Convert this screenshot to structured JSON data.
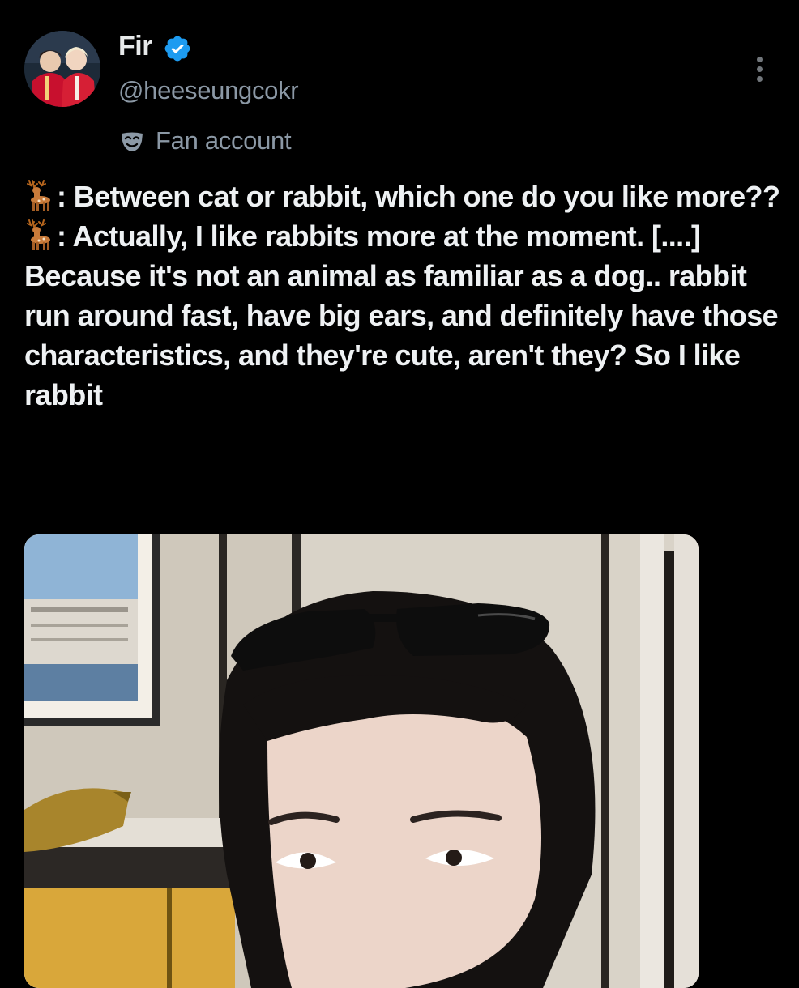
{
  "author": {
    "display_name": "Fir",
    "handle": "@heeseungcokr",
    "verified": true,
    "account_label": "Fan account"
  },
  "icons": {
    "verified": "verified-badge-icon",
    "more": "more-options-icon",
    "label": "mask-icon",
    "speaker": "deer-emoji-icon"
  },
  "tweet": {
    "lines": [
      ": Between cat or rabbit, which one do you like more??",
      ": Actually, I like rabbits more at the moment. [....] Because it's not an animal as familiar as a dog.. rabbit run around fast, have big ears, and definitely have those characteristics, and they're cute, aren't they? So I like rabbit"
    ]
  },
  "colors": {
    "background": "#000000",
    "text": "#e7e9ea",
    "secondary_text": "#8b98a5",
    "verified_badge": "#1d9bf0"
  }
}
